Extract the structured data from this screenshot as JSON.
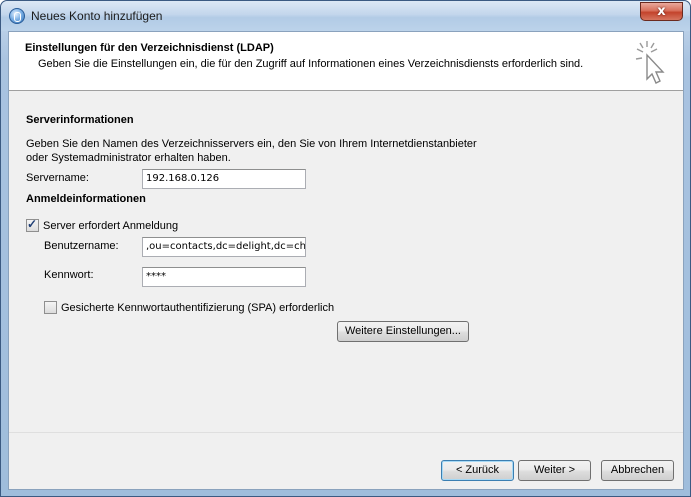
{
  "window": {
    "title": "Neues Konto hinzufügen",
    "close_label": "x"
  },
  "header": {
    "title": "Einstellungen für den Verzeichnisdienst (LDAP)",
    "subtitle": "Geben Sie die Einstellungen ein, die für den Zugriff auf Informationen eines Verzeichnisdiensts erforderlich sind."
  },
  "server_info": {
    "section_title": "Serverinformationen",
    "description_line1": "Geben Sie den Namen des Verzeichnisservers ein, den Sie von Ihrem Internetdienstanbieter",
    "description_line2": "oder Systemadministrator erhalten haben.",
    "servername_label": "Servername:",
    "servername_value": "192.168.0.126"
  },
  "login_info": {
    "section_title": "Anmeldeinformationen",
    "requires_login_label": "Server erfordert Anmeldung",
    "requires_login_checked": true,
    "username_label": "Benutzername:",
    "username_value": ",ou=contacts,dc=delight,dc=ch",
    "password_label": "Kennwort:",
    "password_value": "****",
    "spa_label": "Gesicherte Kennwortauthentifizierung (SPA) erforderlich",
    "spa_checked": false,
    "more_settings_label": "Weitere Einstellungen..."
  },
  "footer": {
    "back_label": "< Zurück",
    "next_label": "Weiter >",
    "cancel_label": "Abbrechen"
  }
}
